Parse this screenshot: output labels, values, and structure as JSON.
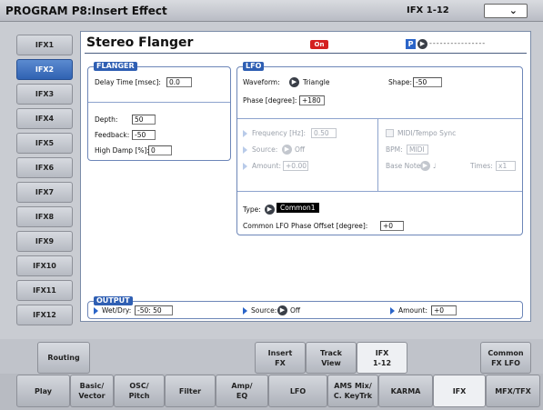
{
  "header": {
    "title": "PROGRAM P8:Insert Effect",
    "ifx_label": "IFX 1-12",
    "dropdown_icon": "chevron-down-icon"
  },
  "ifx_tabs": [
    "IFX1",
    "IFX2",
    "IFX3",
    "IFX4",
    "IFX5",
    "IFX6",
    "IFX7",
    "IFX8",
    "IFX9",
    "IFX10",
    "IFX11",
    "IFX12"
  ],
  "active_ifx": "IFX2",
  "effect": {
    "name": "Stereo Flanger",
    "on_label": "On",
    "p_badge": "P",
    "chain": "----------------"
  },
  "flanger": {
    "label": "FLANGER",
    "delay_time_label": "Delay Time [msec]:",
    "delay_time": "0.0",
    "depth_label": "Depth:",
    "depth": "50",
    "feedback_label": "Feedback:",
    "feedback": "-50",
    "high_damp_label": "High Damp [%]:",
    "high_damp": "0"
  },
  "lfo": {
    "label": "LFO",
    "waveform_label": "Waveform:",
    "waveform": "Triangle",
    "shape_label": "Shape:",
    "shape": "-50",
    "phase_label": "Phase [degree]:",
    "phase": "+180",
    "frequency_label": "Frequency [Hz]:",
    "frequency": "0.50",
    "source_label": "Source:",
    "source": "Off",
    "amount_label": "Amount:",
    "amount": "+0.00",
    "midi_sync_label": "MIDI/Tempo Sync",
    "bpm_label": "BPM:",
    "bpm": "MIDI",
    "base_note_label": "Base Note:",
    "base_note": "♩",
    "times_label": "Times:",
    "times": "x1",
    "type_label": "Type:",
    "type": "Common1",
    "common_phase_label": "Common LFO Phase Offset [degree]:",
    "common_phase": "+0"
  },
  "output": {
    "label": "OUTPUT",
    "wet_dry_label": "Wet/Dry:",
    "wet_dry": "-50: 50",
    "source_label": "Source:",
    "source": "Off",
    "amount_label": "Amount:",
    "amount": "+0"
  },
  "page_tabs": [
    {
      "label": "Routing",
      "active": false
    },
    {
      "label": "Insert\nFX",
      "active": false
    },
    {
      "label": "Track\nView",
      "active": false
    },
    {
      "label": "IFX\n1-12",
      "active": true
    },
    {
      "label": "Common\nFX LFO",
      "active": false
    }
  ],
  "mode_tabs": [
    {
      "label": "Play"
    },
    {
      "label": "Basic/\nVector"
    },
    {
      "label": "OSC/\nPitch"
    },
    {
      "label": "Filter"
    },
    {
      "label": "Amp/\nEQ"
    },
    {
      "label": "LFO"
    },
    {
      "label": "AMS Mix/\nC. KeyTrk"
    },
    {
      "label": "KARMA"
    },
    {
      "label": "IFX",
      "active": true
    },
    {
      "label": "MFX/TFX"
    }
  ],
  "colors": {
    "accent": "#2f5fb3",
    "on_red": "#d42020",
    "active_tab": "#3062b2"
  }
}
